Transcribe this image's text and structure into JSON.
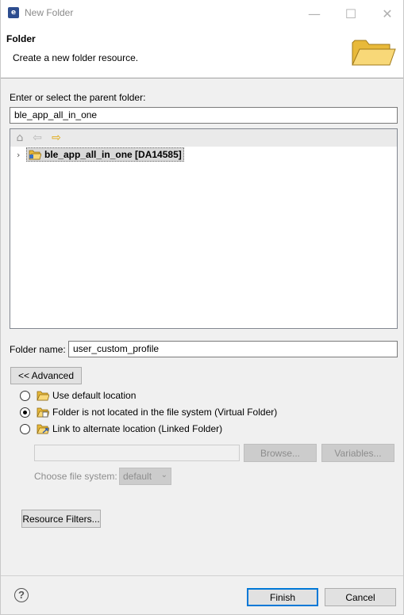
{
  "window": {
    "title": "New Folder",
    "app_icon_glyph": "e",
    "minimize_glyph": "—",
    "maximize_glyph": "☐",
    "close_glyph": "✕"
  },
  "header": {
    "title": "Folder",
    "description": "Create a new folder resource."
  },
  "parent": {
    "label": "Enter or select the parent folder:",
    "value": "ble_app_all_in_one"
  },
  "tree": {
    "toolbar": {
      "home_glyph": "⌂",
      "back_glyph": "⇦",
      "forward_glyph": "⇨"
    },
    "expander_glyph": "›",
    "items": [
      {
        "label": "ble_app_all_in_one [DA14585]"
      }
    ]
  },
  "folder_name": {
    "label": "Folder name:",
    "value": "user_custom_profile"
  },
  "advanced_button": "<< Advanced",
  "location_options": [
    {
      "label": "Use default location",
      "checked": false
    },
    {
      "label": "Folder is not located in the file system (Virtual Folder)",
      "checked": true
    },
    {
      "label": "Link to alternate location (Linked Folder)",
      "checked": false
    }
  ],
  "link": {
    "path_value": "",
    "browse_label": "Browse...",
    "variables_label": "Variables..."
  },
  "file_system": {
    "label": "Choose file system:",
    "selected": "default",
    "arrow_glyph": "⌄"
  },
  "resource_filters_label": "Resource Filters...",
  "help_glyph": "?",
  "finish_label": "Finish",
  "cancel_label": "Cancel",
  "colors": {
    "accent": "#0078d7",
    "folder_yellow": "#f3c84b"
  }
}
